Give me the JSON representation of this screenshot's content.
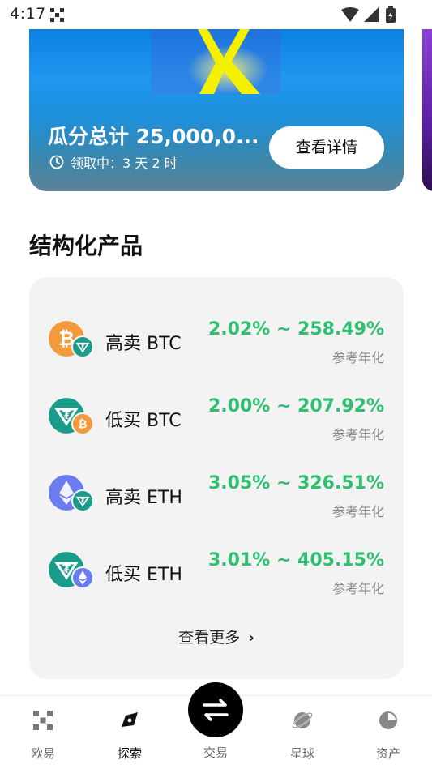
{
  "status_bar": {
    "time": "4:17"
  },
  "banner": {
    "title": "瓜分总计 25,000,0...",
    "subtitle": "领取中：3 天 2 时",
    "button": "查看详情"
  },
  "section": {
    "title": "结构化产品"
  },
  "products": [
    {
      "name": "高卖 BTC",
      "rate": "2.02% ~ 258.49%",
      "hint": "参考年化",
      "main_icon": "bitcoin-icon",
      "sub_icon": "tether-icon",
      "main_color": "#f29a3c",
      "sub_color": "#1a9c8a"
    },
    {
      "name": "低买 BTC",
      "rate": "2.00% ~ 207.92%",
      "hint": "参考年化",
      "main_icon": "tether-icon",
      "sub_icon": "bitcoin-icon",
      "main_color": "#1a9c8a",
      "sub_color": "#f29a3c"
    },
    {
      "name": "高卖 ETH",
      "rate": "3.05% ~ 326.51%",
      "hint": "参考年化",
      "main_icon": "ethereum-icon",
      "sub_icon": "tether-icon",
      "main_color": "#6b7bf0",
      "sub_color": "#1a9c8a"
    },
    {
      "name": "低买 ETH",
      "rate": "3.01% ~ 405.15%",
      "hint": "参考年化",
      "main_icon": "tether-icon",
      "sub_icon": "ethereum-icon",
      "main_color": "#1a9c8a",
      "sub_color": "#6b7bf0"
    }
  ],
  "more": {
    "label": "查看更多"
  },
  "nav": {
    "items": [
      {
        "label": "欧易",
        "icon": "okx-logo-icon"
      },
      {
        "label": "探索",
        "icon": "compass-icon"
      },
      {
        "label": "交易",
        "icon": "swap-icon"
      },
      {
        "label": "星球",
        "icon": "planet-icon"
      },
      {
        "label": "资产",
        "icon": "pie-chart-icon"
      }
    ],
    "active": "探索"
  },
  "colors": {
    "accent_green": "#2fbf71",
    "banner_blue": "#1e98f0",
    "card_bg": "#f3f3f3"
  }
}
